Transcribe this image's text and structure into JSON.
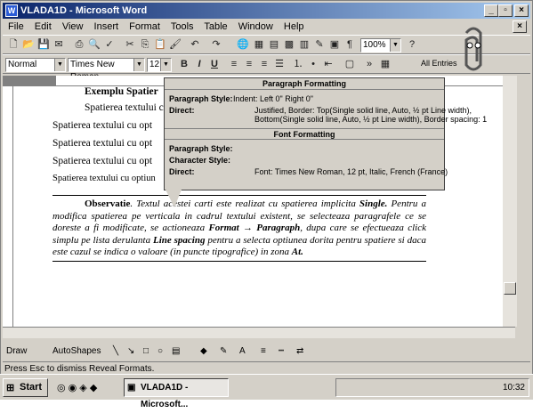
{
  "window": {
    "title": "VLADA1D - Microsoft Word"
  },
  "menu": [
    "File",
    "Edit",
    "View",
    "Insert",
    "Format",
    "Tools",
    "Table",
    "Window",
    "Help"
  ],
  "formatting": {
    "style": "Normal",
    "font": "Times New Roman",
    "size": "12",
    "zoom": "100%",
    "all_entries": "All Entries"
  },
  "doc": {
    "line_top": "Exemplu  Spatier",
    "lines": [
      "Spatierea textului c",
      "Spatierea textului cu opt",
      "Spatierea textului cu opt",
      "Spatierea textului cu opt",
      "Spatierea textului cu optiun"
    ],
    "obs_title": "Observatie",
    "obs_a": ". Textul acestei carti este realizat cu spatierea implicita ",
    "obs_single": "Single.",
    "obs_b": " Pentru a modifica spatierea pe verticala in cadrul textului existent, se selecteaza paragrafele ce se doreste a fi modificate, se actioneaza ",
    "obs_format": "Format → Paragraph",
    "obs_c": ", dupa care se efectueaza click simplu pe lista derulanta ",
    "obs_ls": "Line spacing",
    "obs_d": " pentru a selecta optiunea dorita pentru spatiere si daca este cazul se indica o valoare (in puncte tipografice) in zona ",
    "obs_at": "At."
  },
  "popup": {
    "para_head": "Paragraph Formatting",
    "para_style_label": "Paragraph Style:",
    "para_style_val": "Indent:  Left  0\"  Right  0\"",
    "direct_label": "Direct:",
    "direct_val1": "Justified, Border: Top(Single solid line, Auto, ½ pt Line width),",
    "direct_val2": "Bottom(Single solid line, Auto, ½ pt Line width), Border spacing: 1",
    "font_head": "Font Formatting",
    "f_para_style_label": "Paragraph Style:",
    "f_char_style_label": "Character Style:",
    "f_direct_label": "Direct:",
    "f_direct_val": "Font: Times New Roman, 12 pt, Italic, French (France)"
  },
  "drawbar": {
    "draw": "Draw",
    "autoshapes": "AutoShapes"
  },
  "status": "Press Esc to dismiss Reveal Formats.",
  "taskbar": {
    "start": "Start",
    "task": "VLADA1D - Microsoft...",
    "clock": "10:32"
  }
}
